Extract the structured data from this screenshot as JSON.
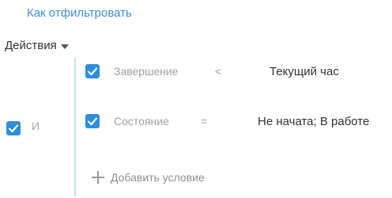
{
  "help_link": "Как отфильтровать",
  "actions_menu": {
    "label": "Действия"
  },
  "group": {
    "checked": true,
    "operator": "И"
  },
  "conditions": [
    {
      "checked": true,
      "field": "Завершение",
      "operator": "<",
      "value": "Текущий час"
    },
    {
      "checked": true,
      "field": "Состояние",
      "operator": "=",
      "value": "Не начата; В работе"
    }
  ],
  "add_condition": {
    "label": "Добавить условие"
  },
  "colors": {
    "link": "#3b8fd9",
    "checkbox": "#2d8ee0",
    "group_line": "#bfe0f6"
  }
}
